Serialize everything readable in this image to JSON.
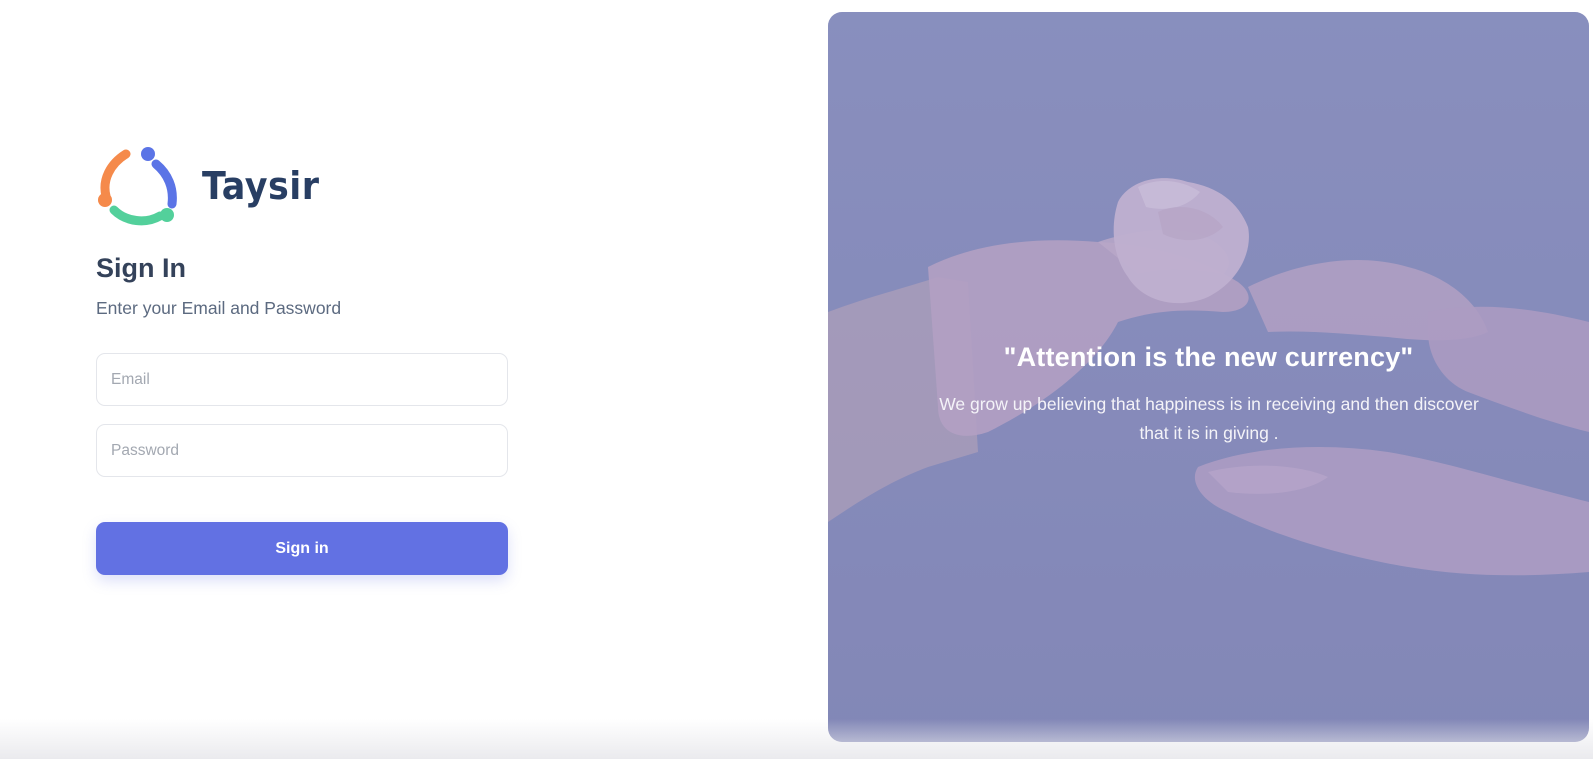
{
  "brand": {
    "name": "Taysir"
  },
  "form": {
    "title": "Sign In",
    "subtitle": "Enter your Email and Password",
    "email_placeholder": "Email",
    "password_placeholder": "Password",
    "submit_label": "Sign in"
  },
  "hero": {
    "quote": "\"Attention is the new currency\"",
    "body": "We grow up believing that happiness is in receiving and then discover that it is in giving ."
  },
  "colors": {
    "accent": "#6271e3",
    "brand_text": "#283e63",
    "panel_overlay": "#8589b8"
  },
  "icons": {
    "logo": "three-people-circle-logo"
  }
}
